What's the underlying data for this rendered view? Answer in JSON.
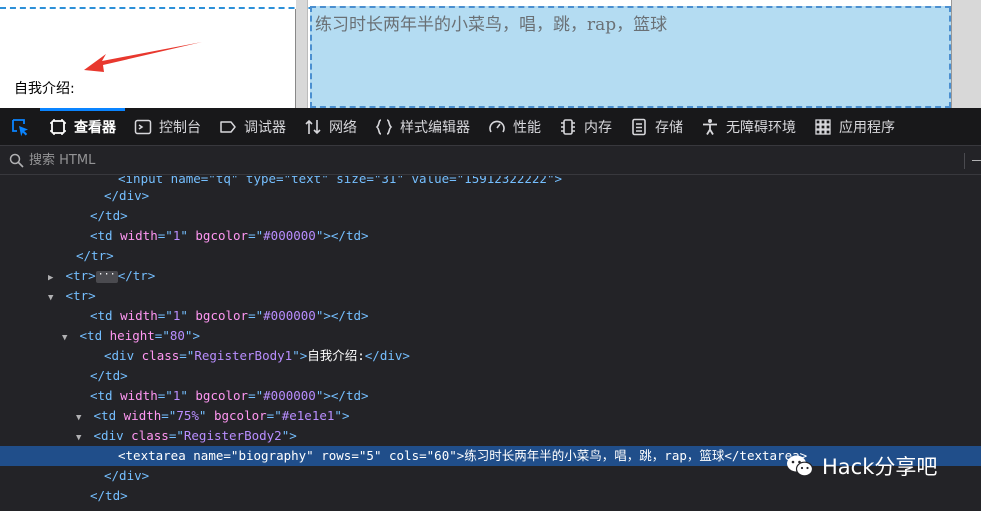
{
  "page": {
    "label": "自我介绍:",
    "textarea_value": "练习时长两年半的小菜鸟，唱，跳，rap，篮球"
  },
  "devtools": {
    "tabs": [
      {
        "label": "查看器",
        "icon": "inspector-icon",
        "active": true
      },
      {
        "label": "控制台",
        "icon": "console-icon"
      },
      {
        "label": "调试器",
        "icon": "debugger-icon"
      },
      {
        "label": "网络",
        "icon": "network-icon"
      },
      {
        "label": "样式编辑器",
        "icon": "style-editor-icon"
      },
      {
        "label": "性能",
        "icon": "performance-icon"
      },
      {
        "label": "内存",
        "icon": "memory-icon"
      },
      {
        "label": "存储",
        "icon": "storage-icon"
      },
      {
        "label": "无障碍环境",
        "icon": "accessibility-icon"
      },
      {
        "label": "应用程序",
        "icon": "application-icon"
      }
    ],
    "search_placeholder": "搜索 HTML"
  },
  "markup": {
    "truncated_line": "<input name=\"tq\" type=\"text\" size=\"31\" value=\"15912322222\">",
    "lines": [
      {
        "tag_close": "</div>"
      },
      {
        "tag_close": "</td>"
      },
      {
        "open_tag": "td",
        "attrs": [
          [
            "width",
            "1"
          ],
          [
            "bgcolor",
            "#000000"
          ]
        ],
        "close": "</td>"
      },
      {
        "tag_close": "</tr>"
      },
      {
        "collapsed": true,
        "open_tag": "tr",
        "close": "</tr>"
      },
      {
        "expanded": true,
        "open_tag": "tr"
      },
      {
        "open_tag": "td",
        "attrs": [
          [
            "width",
            "1"
          ],
          [
            "bgcolor",
            "#000000"
          ]
        ],
        "close": "</td>"
      },
      {
        "expanded": true,
        "open_tag": "td",
        "attrs": [
          [
            "height",
            "80"
          ]
        ]
      },
      {
        "open_tag": "div",
        "attrs": [
          [
            "class",
            "RegisterBody1"
          ]
        ],
        "text": "自我介绍:",
        "close": "</div>"
      },
      {
        "tag_close": "</td>"
      },
      {
        "open_tag": "td",
        "attrs": [
          [
            "width",
            "1"
          ],
          [
            "bgcolor",
            "#000000"
          ]
        ],
        "close": "</td>"
      },
      {
        "expanded": true,
        "open_tag": "td",
        "attrs": [
          [
            "width",
            "75%"
          ],
          [
            "bgcolor",
            "#e1e1e1"
          ]
        ]
      },
      {
        "expanded": true,
        "open_tag": "div",
        "attrs": [
          [
            "class",
            "RegisterBody2"
          ]
        ]
      },
      {
        "selected": true,
        "open_tag": "textarea",
        "attrs": [
          [
            "name",
            "biography"
          ],
          [
            "rows",
            "5"
          ],
          [
            "cols",
            "60"
          ]
        ],
        "text": "练习时长两年半的小菜鸟，唱，跳，rap，篮球",
        "close": "</textarea>"
      },
      {
        "tag_close": "</div>"
      },
      {
        "tag_close": "</td>"
      }
    ]
  },
  "watermark": {
    "text": "Hack分享吧",
    "icon": "wechat-icon"
  }
}
